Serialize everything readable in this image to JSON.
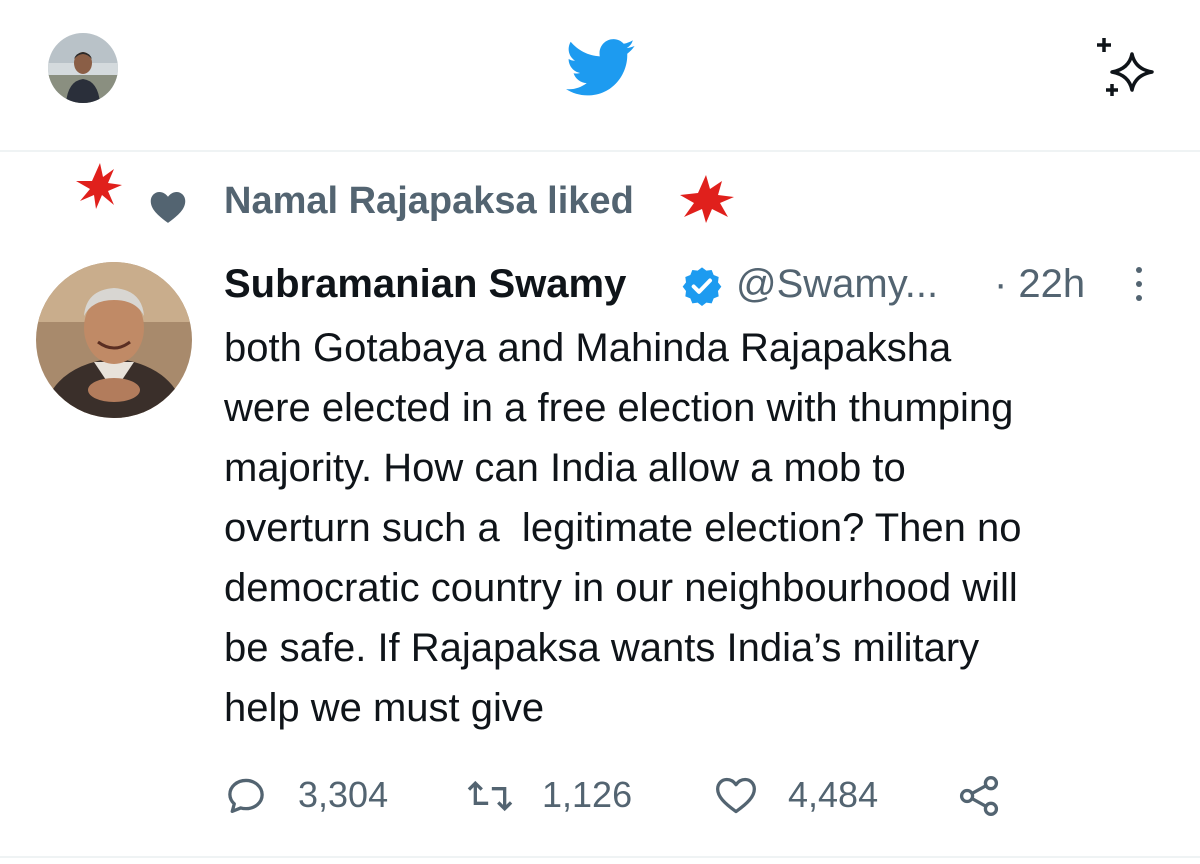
{
  "header": {
    "avatar_icon": "profile-avatar",
    "logo_icon": "twitter-bird-icon",
    "sparkle_icon": "sparkle-icon",
    "colors": {
      "brand": "#1d9bf0",
      "border": "#eff3f4"
    }
  },
  "social_context": {
    "text": "Namal Rajapaksa liked",
    "icon": "heart-filled-icon",
    "decoration_color": "#e0201c"
  },
  "tweet": {
    "author_name": "Subramanian Swamy",
    "verified": true,
    "handle": "@Swamy...",
    "time": "· 22h",
    "text": "both Gotabaya and Mahinda Rajapaksha\nwere elected in a free election with thumping\nmajority. How can India allow a mob to\noverturn such a  legitimate election? Then no\ndemocratic country in our neighbourhood will\nbe safe. If Rajapaksa wants India’s military\nhelp we must give",
    "stats": {
      "replies": "3,304",
      "retweets": "1,126",
      "likes": "4,484"
    },
    "colors": {
      "text": "#0f1419",
      "secondary": "#536471",
      "verified": "#1d9bf0"
    }
  }
}
